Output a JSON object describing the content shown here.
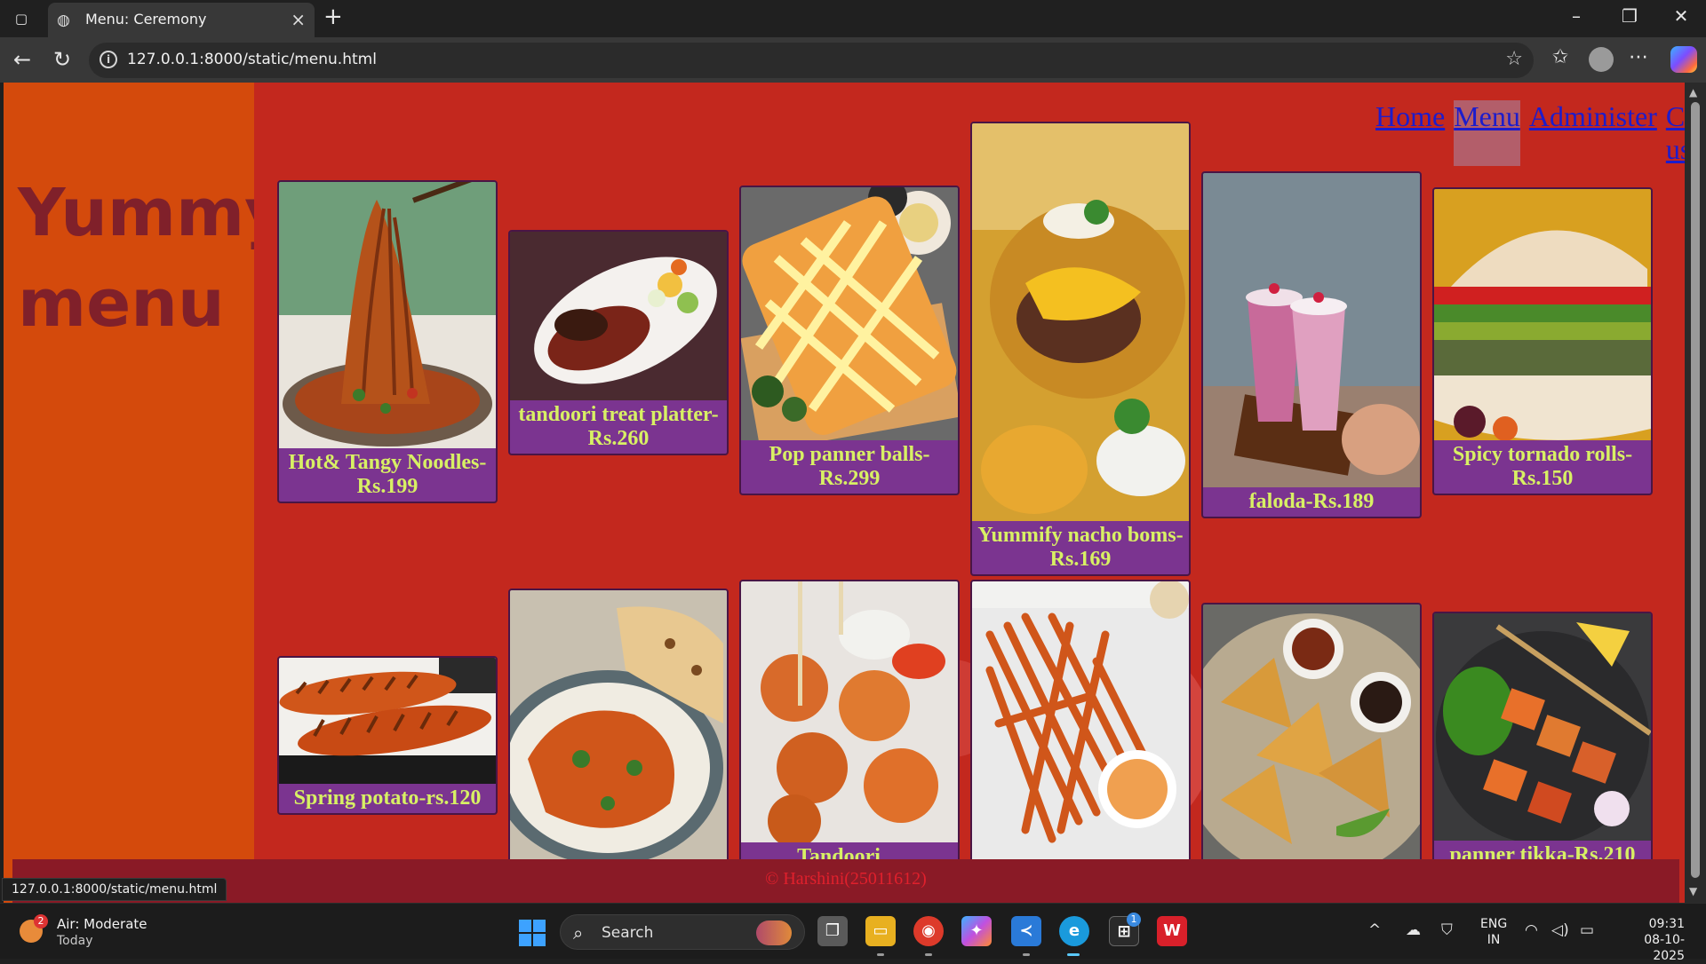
{
  "browser": {
    "tab_title": "Menu: Ceremony",
    "url": "127.0.0.1:8000/static/menu.html",
    "status_url": "127.0.0.1:8000/static/menu.html"
  },
  "page": {
    "brand": "Yummy menu",
    "nav": [
      {
        "label": "Home",
        "active": false
      },
      {
        "label": "Menu",
        "active": true
      },
      {
        "label": "Administer",
        "active": false
      },
      {
        "label": "Contact-us",
        "active": false
      }
    ],
    "menu_items": [
      {
        "caption": "Hot& Tangy Noodles-Rs.199",
        "photo": "noodles"
      },
      {
        "caption": "tandoori treat platter-Rs.260",
        "photo": "tandoori-platter"
      },
      {
        "caption": "Pop panner balls-Rs.299",
        "photo": "panner-balls"
      },
      {
        "caption": "Yummify nacho boms-Rs.169",
        "photo": "nacho-boms"
      },
      {
        "caption": "faloda-Rs.189",
        "photo": "faloda"
      },
      {
        "caption": "Spicy tornado rolls-Rs.150",
        "photo": "burger-roll"
      },
      {
        "caption": "Spring potato-rs.120",
        "photo": "spring-potato"
      },
      {
        "caption": "",
        "photo": "curry-naan"
      },
      {
        "caption": "Tandoori ...",
        "photo": "tandoori-momos"
      },
      {
        "caption": "",
        "photo": "sweet-potato-fries"
      },
      {
        "caption": "",
        "photo": "samosa"
      },
      {
        "caption": "panner tikka-Rs.210",
        "photo": "panner-tikka"
      }
    ],
    "footer": "© Harshini(25011612)"
  },
  "taskbar": {
    "weather_title": "Air: Moderate",
    "weather_sub": "Today",
    "weather_badge": "2",
    "search_label": "Search",
    "store_badge": "1",
    "lang_line1": "ENG",
    "lang_line2": "IN",
    "time": "09:31",
    "date": "08-10-2025"
  },
  "colors": {
    "sidebar": "#d44a0c",
    "main": "#c3281e",
    "card": "#7b3490",
    "caption": "#d8f064",
    "brand": "#80202a",
    "footer_bg": "#8a1a26"
  }
}
